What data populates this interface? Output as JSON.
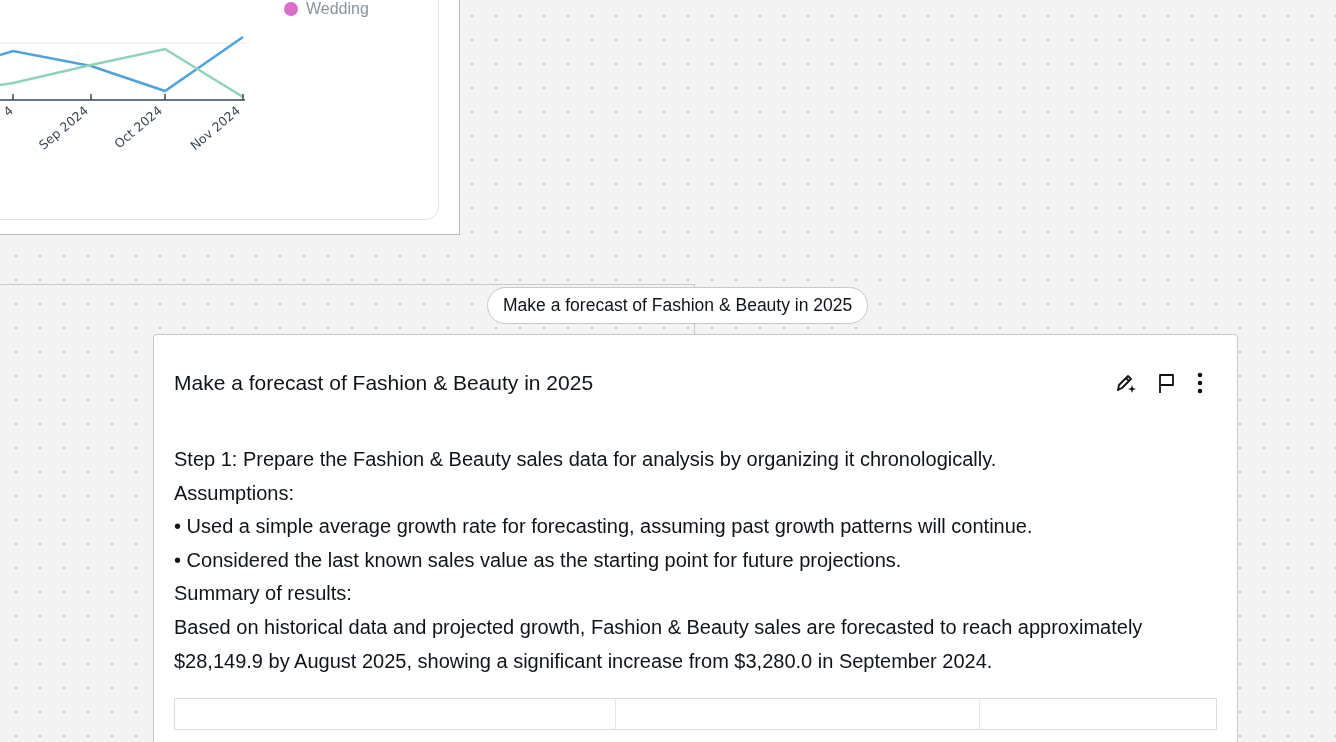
{
  "chart_card": {
    "legend": [
      {
        "label": "Wedding",
        "color": "#d86fc8"
      }
    ],
    "x_labels": [
      "4",
      "Sep 2024",
      "Oct 2024",
      "Nov 2024"
    ],
    "series": [
      {
        "color": "#4ea3dc"
      },
      {
        "color": "#8fd3bb"
      }
    ]
  },
  "prompt_chip": "Make a forecast of Fashion & Beauty in 2025",
  "answer": {
    "title": "Make a forecast of Fashion & Beauty in 2025",
    "paragraphs": [
      "Step 1: Prepare the Fashion & Beauty sales data for analysis by organizing it chronologically.",
      "Assumptions:",
      "• Used a simple average growth rate for forecasting, assuming past growth patterns will continue.",
      "• Considered the last known sales value as the starting point for future projections.",
      "Summary of results:",
      "Based on historical data and projected growth, Fashion & Beauty sales are forecasted to reach approximately $28,149.9 by August 2025, showing a significant increase from $3,280.0 in September 2024."
    ]
  }
}
